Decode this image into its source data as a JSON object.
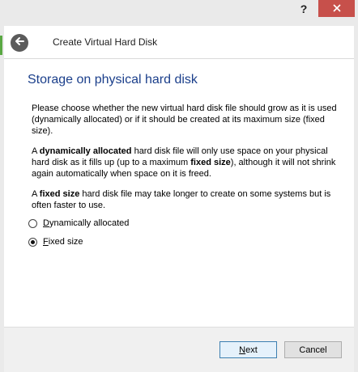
{
  "window": {
    "help_label": "?",
    "close_icon": "close-icon"
  },
  "header": {
    "title": "Create Virtual Hard Disk",
    "back_icon": "back-arrow-icon"
  },
  "content": {
    "section_title": "Storage on physical hard disk",
    "para1": "Please choose whether the new virtual hard disk file should grow as it is used (dynamically allocated) or if it should be created at its maximum size (fixed size).",
    "para2_prefix": "A ",
    "para2_bold1": "dynamically allocated",
    "para2_mid": " hard disk file will only use space on your physical hard disk as it fills up (up to a maximum ",
    "para2_bold2": "fixed size",
    "para2_suffix": "), although it will not shrink again automatically when space on it is freed.",
    "para3_prefix": "A ",
    "para3_bold": "fixed size",
    "para3_suffix": " hard disk file may take longer to create on some systems but is often faster to use.",
    "options": [
      {
        "accel": "D",
        "rest": "ynamically allocated",
        "selected": false
      },
      {
        "accel": "F",
        "rest": "ixed size",
        "selected": true
      }
    ]
  },
  "footer": {
    "next_accel": "N",
    "next_rest": "ext",
    "cancel_label": "Cancel"
  },
  "colors": {
    "title_blue": "#1b3f8b",
    "close_red": "#c7504b",
    "accent_green": "#5aa843"
  }
}
